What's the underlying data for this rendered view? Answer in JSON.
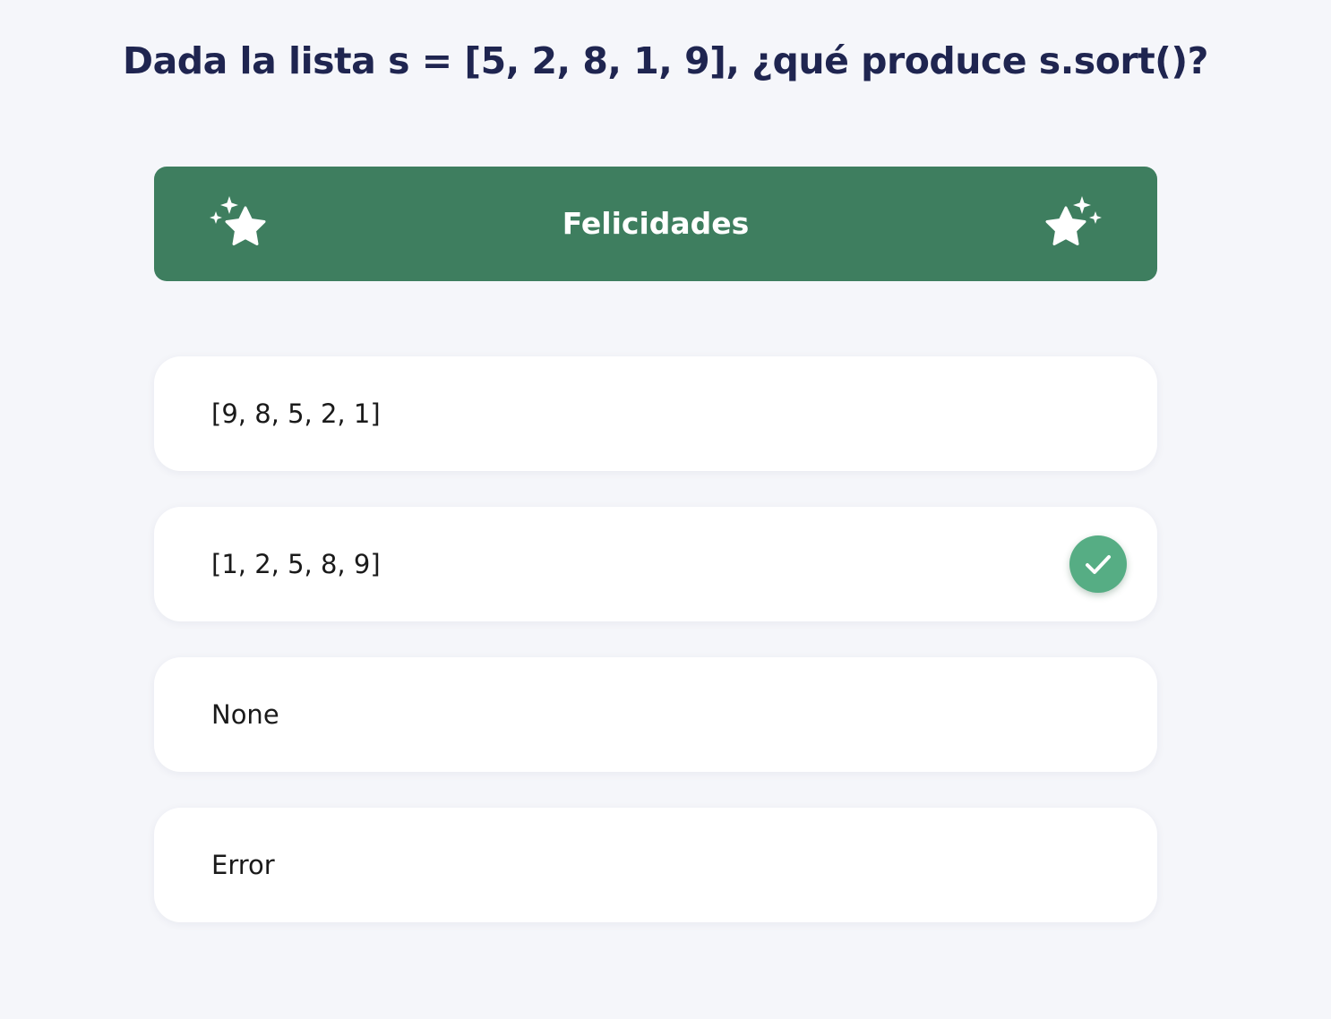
{
  "question": {
    "text": "Dada la lista s = [5, 2, 8, 1, 9], ¿qué produce s.sort()?"
  },
  "result_banner": {
    "title": "Felicidades",
    "left_icon": "sparkle-star-icon",
    "right_icon": "sparkle-star-icon",
    "color": "#3e7e5f"
  },
  "options": [
    {
      "label": "[9, 8, 5, 2, 1]",
      "correct": false
    },
    {
      "label": "[1, 2, 5, 8, 9]",
      "correct": true,
      "icon": "check-icon",
      "icon_color": "#56ad84"
    },
    {
      "label": "None",
      "correct": false
    },
    {
      "label": "Error",
      "correct": false
    }
  ],
  "colors": {
    "background": "#f5f6fa",
    "question_text": "#1f2550",
    "option_background": "#ffffff"
  }
}
